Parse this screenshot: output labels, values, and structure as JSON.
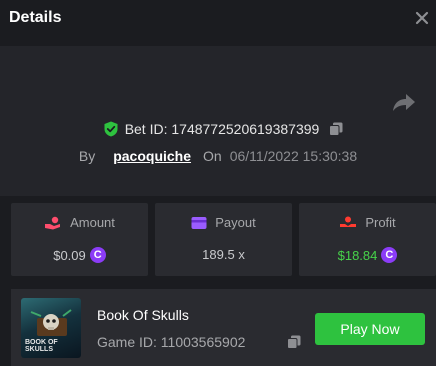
{
  "header": {
    "title": "Details"
  },
  "bet": {
    "id_text": "Bet ID: 1748772520619387399",
    "by_label": "By",
    "user": "pacoquiche",
    "on_label": "On",
    "datetime": "06/11/2022 15:30:38"
  },
  "stats": {
    "amount": {
      "label": "Amount",
      "value": "$0.09"
    },
    "payout": {
      "label": "Payout",
      "value": "189.5 x"
    },
    "profit": {
      "label": "Profit",
      "value": "$18.84"
    }
  },
  "game": {
    "name": "Book Of Skulls",
    "id_text": "Game ID: 11003565902",
    "thumb_text_1": "BOOK OF",
    "thumb_text_2": "SKULLS",
    "play_label": "Play Now"
  },
  "coin_symbol": "C",
  "colors": {
    "accent_green": "#2ec23f",
    "coin_purple": "#8b3cf7",
    "profit_green": "#47d34a"
  }
}
